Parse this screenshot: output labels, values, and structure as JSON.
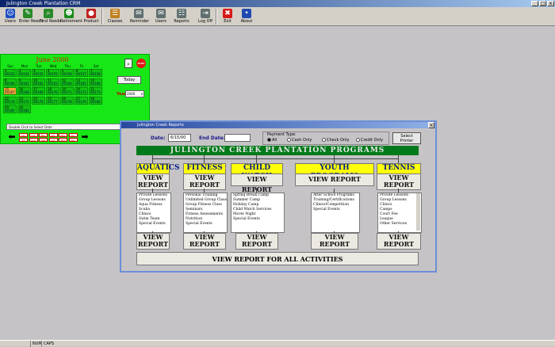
{
  "window": {
    "title": "Julington Creek Plantation CRM"
  },
  "toolbar": {
    "items": [
      {
        "label": "Users",
        "color": "#2050c0",
        "glyph": "☺"
      },
      {
        "label": "Enter Reeds",
        "color": "#2a8a2a",
        "glyph": "✎"
      },
      {
        "label": "Find Reeds",
        "color": "#2a8a2a",
        "glyph": "⌕"
      },
      {
        "label": "Retirement",
        "color": "#1a8a1a",
        "glyph": "☻"
      },
      {
        "label": "Product",
        "color": "#c02020",
        "glyph": "●"
      },
      {
        "label": "Classes",
        "color": "#c08020",
        "glyph": "☰"
      },
      {
        "label": "Reminder",
        "color": "#607070",
        "glyph": "✉"
      },
      {
        "label": "Users",
        "color": "#607070",
        "glyph": "✉"
      },
      {
        "label": "Reports",
        "color": "#607070",
        "glyph": "☷"
      },
      {
        "label": "Log Off",
        "color": "#607070",
        "glyph": "⇥"
      },
      {
        "label": "Exit",
        "color": "#d81818",
        "glyph": "✖"
      },
      {
        "label": "About",
        "color": "#204ab0",
        "glyph": "•"
      }
    ]
  },
  "calendar": {
    "title": "June 2000",
    "weekdays": [
      "Sun",
      "Mon",
      "Tue",
      "Wed",
      "Thu",
      "Fri",
      "Sat"
    ],
    "days": [
      {
        "n": "1",
        "c": "00152"
      },
      {
        "n": "2",
        "c": "00154"
      },
      {
        "n": "3",
        "c": "00155"
      },
      {
        "n": "4",
        "c": "00155"
      },
      {
        "n": "5",
        "c": "00156"
      },
      {
        "n": "6",
        "c": "00157"
      },
      {
        "n": "7",
        "c": "00158"
      },
      {
        "n": "8",
        "c": "00160"
      },
      {
        "n": "9",
        "c": "00161"
      },
      {
        "n": "10",
        "c": "00162"
      },
      {
        "n": "11",
        "c": "00163"
      },
      {
        "n": "12",
        "c": "00164"
      },
      {
        "n": "13",
        "c": "00165"
      },
      {
        "n": "14",
        "c": "00166"
      },
      {
        "n": "15",
        "c": "00167"
      },
      {
        "n": "16",
        "c": "00168"
      },
      {
        "n": "17",
        "c": "00169"
      },
      {
        "n": "18",
        "c": "00170"
      },
      {
        "n": "19",
        "c": "00171"
      },
      {
        "n": "20",
        "c": "00172"
      },
      {
        "n": "21",
        "c": "00173"
      },
      {
        "n": "22",
        "c": "00174"
      },
      {
        "n": "23",
        "c": "00175"
      },
      {
        "n": "24",
        "c": "00176"
      },
      {
        "n": "25",
        "c": "00177"
      },
      {
        "n": "26",
        "c": "00178"
      },
      {
        "n": "27",
        "c": "00179"
      },
      {
        "n": "28",
        "c": "00180"
      },
      {
        "n": "29",
        "c": "00181"
      },
      {
        "n": "30",
        "c": "00182"
      }
    ],
    "today_label": "Today",
    "year_label": "Year",
    "year_value": "2000",
    "dblclick_hint": "Double Click to Select Date",
    "months": [
      "Jan",
      "Feb",
      "Mar",
      "Apr",
      "May",
      "Jun",
      "Jul",
      "Aug",
      "Sep",
      "Oct",
      "Nov",
      "Dec"
    ]
  },
  "reports": {
    "window_title": "Julington Creek Reports",
    "date_label": "Date:",
    "date_value": "6/15/00",
    "end_date_label": "End Date:",
    "end_date_value": "",
    "payment_type_label": "Payment Type:",
    "payment_options": [
      "All",
      "Cash Only",
      "Check Only",
      "Credit Only"
    ],
    "select_printer": [
      "Select",
      "Printer"
    ],
    "banner": "JULINGTON CREEK PLANTATION PROGRAMS",
    "categories": [
      {
        "name": "AQUATICS",
        "items": [
          "Private Lessons",
          "Group Lessons",
          "Aqua Fitness",
          "Scuba",
          "Clinics",
          "Swim Team",
          "Special Events"
        ]
      },
      {
        "name": "FITNESS",
        "items": [
          "Personal Training",
          "Unlimited Group Class",
          "Group Fitness Class",
          "Seminars",
          "Fitness Assessments",
          "Nutrition",
          "Special Events"
        ]
      },
      {
        "name": "CHILD WATCH",
        "items": [
          "Spring Break Camp",
          "Summer Camp",
          "Holiday Camp",
          "Child Watch Services",
          "Movie Night",
          "Special Events"
        ]
      },
      {
        "name": "YOUTH PROGRAMS",
        "items": [
          "After School Programs",
          "Training/Certifications",
          "Clinics/Competition",
          "Special Events"
        ]
      },
      {
        "name": "TENNIS",
        "items": [
          "Private Lessons",
          "Group Lessons",
          "Clinics",
          "Camps",
          "Court Fee",
          "League",
          "Other Services"
        ]
      }
    ],
    "view_report": "VIEW REPORT",
    "view_report_two": [
      "VIEW",
      "REPORT"
    ],
    "all_activities": "VIEW REPORT FOR ALL ACTIVITIES"
  },
  "statusbar": {
    "cells": [
      "NUM",
      "CAPS"
    ]
  }
}
